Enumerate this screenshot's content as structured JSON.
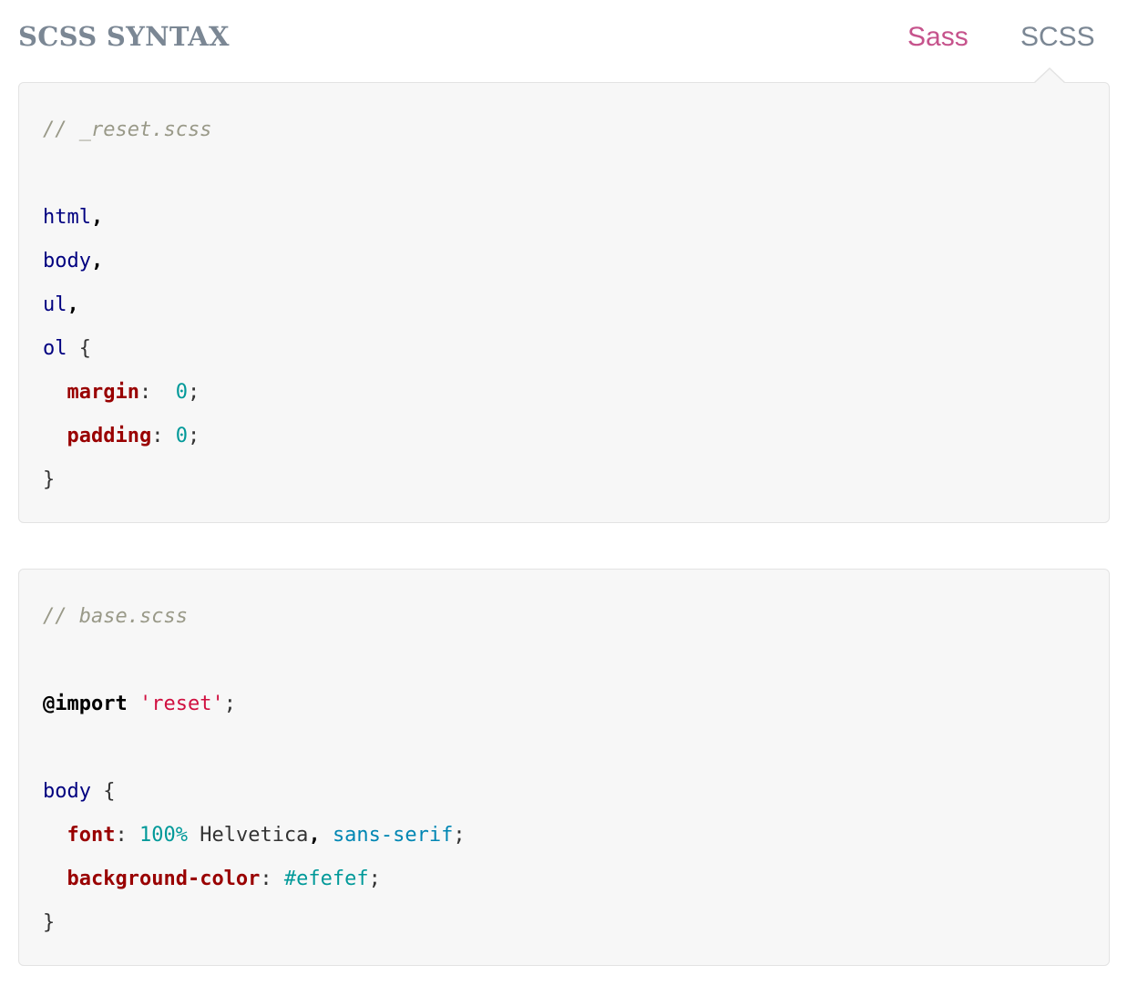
{
  "header": {
    "title": "SCSS SYNTAX",
    "tabs": [
      {
        "label": "Sass",
        "active": false
      },
      {
        "label": "SCSS",
        "active": true
      }
    ]
  },
  "colors": {
    "accent": "#c6538c",
    "muted": "#7b8794",
    "code_bg": "#f7f7f7"
  },
  "code_blocks": [
    {
      "comment": "// _reset.scss",
      "selectors": [
        "html",
        "body",
        "ul",
        "ol"
      ],
      "declarations": [
        {
          "property": "margin",
          "value": "0"
        },
        {
          "property": "padding",
          "value": "0"
        }
      ]
    },
    {
      "comment": "// base.scss",
      "import_keyword": "@import",
      "import_value": "'reset'",
      "selector": "body",
      "font_property": "font",
      "font_size": "100%",
      "font_family": "Helvetica",
      "font_generic": "sans-serif",
      "bg_property": "background-color",
      "bg_value": "#efefef"
    }
  ]
}
